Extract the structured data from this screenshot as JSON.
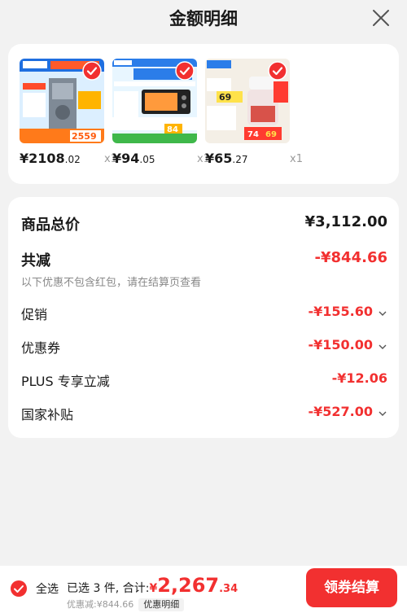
{
  "header": {
    "title": "金额明细"
  },
  "products": [
    {
      "price_int": "¥2108",
      "price_dec": ".02",
      "qty": "x1"
    },
    {
      "price_int": "¥94",
      "price_dec": ".05",
      "qty": "x1"
    },
    {
      "price_int": "¥65",
      "price_dec": ".27",
      "qty": "x1"
    }
  ],
  "summary": {
    "total_label": "商品总价",
    "total_value": "¥3,112.00",
    "reduce_label": "共减",
    "reduce_value": "-¥844.66",
    "note": "以下优惠不包含红包，请在结算页查看",
    "items": [
      {
        "label": "促销",
        "value": "-¥155.60"
      },
      {
        "label": "优惠券",
        "value": "-¥150.00"
      },
      {
        "label": "PLUS 专享立减",
        "value": "-¥12.06"
      },
      {
        "label": "国家补贴",
        "value": "-¥527.00"
      }
    ]
  },
  "bottom": {
    "select_all": "全选",
    "selected_text": "已选 3 件, 合计:",
    "currency": "¥",
    "total_int": "2,267",
    "total_dec": ".34",
    "discount_text": "优惠减:¥844.66",
    "detail_badge": "优惠明细",
    "checkout": "领券结算"
  },
  "colors": {
    "accent": "#f23030",
    "background": "#f2f2f2",
    "card": "#ffffff"
  }
}
